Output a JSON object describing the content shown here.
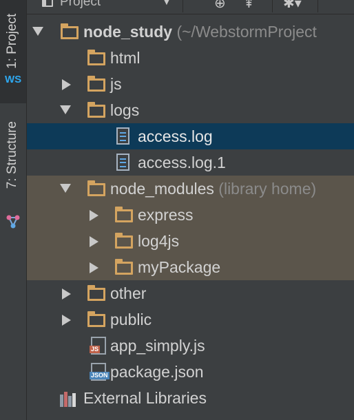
{
  "toolstrip": {
    "project_tab": "1: Project",
    "structure_tab": "7: Structure",
    "ws_logo": "WS"
  },
  "toolbar": {
    "view_label": "Project",
    "chevron_icon": "chevron-down-icon",
    "buttons": [
      "sync-icon",
      "collapse-all-icon",
      "settings-icon"
    ]
  },
  "tree": {
    "root": {
      "name": "node_study",
      "path": "(~/WebstormProject"
    },
    "html": "html",
    "js": "js",
    "logs": "logs",
    "access_log": "access.log",
    "access_log_1": "access.log.1",
    "node_modules": {
      "name": "node_modules",
      "note": "(library home)"
    },
    "express": "express",
    "log4js": "log4js",
    "myPackage": "myPackage",
    "other": "other",
    "public": "public",
    "app_simply": {
      "name": "app_simply.js",
      "badge": "JS"
    },
    "package_json": {
      "name": "package.json",
      "badge": "JSON"
    },
    "external_libraries": "External Libraries"
  },
  "colors": {
    "background": "#3c3f41",
    "selection": "#0d3a58",
    "library_row": "#5b554b",
    "folder": "#d4a460",
    "text": "#d2d2d2",
    "muted": "#8b8b8b"
  }
}
